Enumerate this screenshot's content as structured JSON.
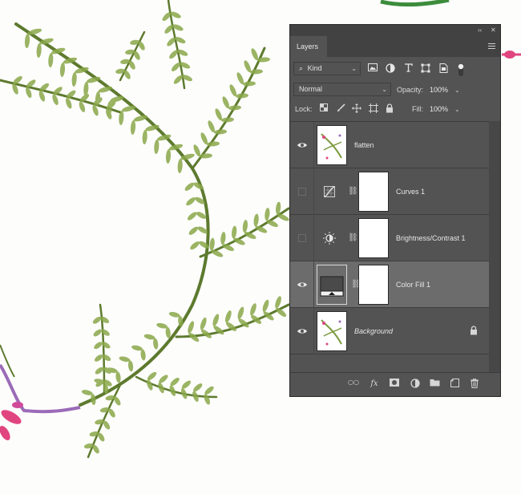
{
  "panel": {
    "title": "Layers",
    "collapse_glyph": "‹‹",
    "close_glyph": "✕",
    "filter": {
      "value": "Kind",
      "glyph": "⌕"
    },
    "blend_mode": "Normal",
    "opacity_label": "Opacity:",
    "opacity_value": "100%",
    "lock_label": "Lock:",
    "fill_label": "Fill:",
    "fill_value": "100%",
    "chevron": "⌄",
    "link_glyph": "⛓",
    "bottom_fx": "fx"
  },
  "layers": [
    {
      "name": "flatten",
      "visible": true,
      "type": "pixel",
      "selected": false
    },
    {
      "name": "Curves 1",
      "visible": false,
      "type": "adjustment-curves",
      "selected": false
    },
    {
      "name": "Brightness/Contrast 1",
      "visible": false,
      "type": "adjustment-brightness",
      "selected": false
    },
    {
      "name": "Color Fill 1",
      "visible": true,
      "type": "fill",
      "selected": true
    },
    {
      "name": "Background",
      "visible": true,
      "type": "background",
      "locked": true,
      "selected": false
    }
  ],
  "colors": {
    "panel_bg": "#535353",
    "panel_header": "#424242",
    "selected_row": "#6c6c6c",
    "fern_green": "#7a9a3f",
    "fern_dark": "#5d7a2e",
    "pink_flower": "#e0457f",
    "purple_stem": "#9b6bb8"
  },
  "icons": {
    "filter": [
      "image-filter-icon",
      "adjustment-filter-icon",
      "type-filter-icon",
      "shape-filter-icon",
      "smart-object-filter-icon",
      "filter-toggle-icon"
    ],
    "lock": [
      "lock-transparent-pixels-icon",
      "lock-image-pixels-icon",
      "lock-position-icon",
      "lock-artboard-icon",
      "lock-all-icon"
    ],
    "bottom": [
      "link-layers-icon",
      "layer-style-icon",
      "add-mask-icon",
      "new-adjustment-layer-icon",
      "new-group-icon",
      "new-layer-icon",
      "delete-layer-icon"
    ]
  }
}
